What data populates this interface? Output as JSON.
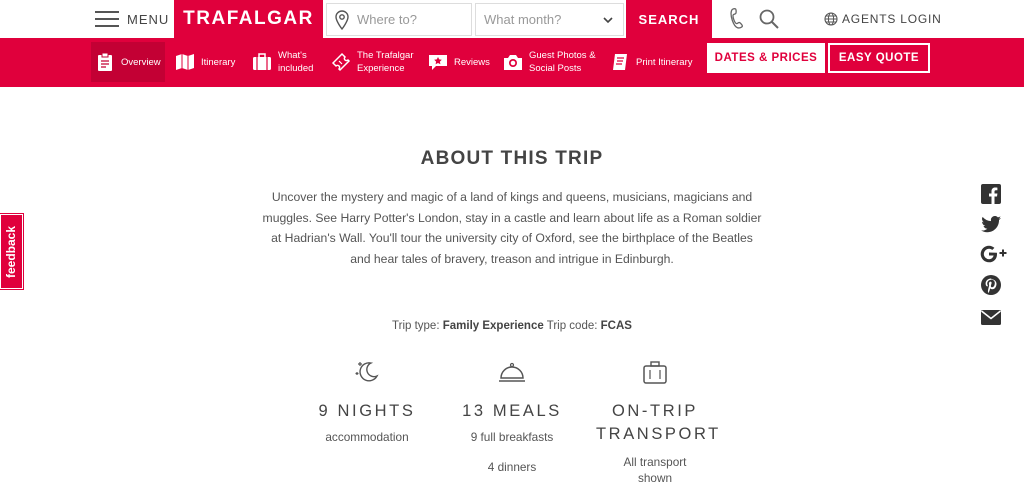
{
  "header": {
    "menu_label": "MENU",
    "logo": "TRAFALGAR",
    "where_placeholder": "Where to?",
    "month_placeholder": "What month?",
    "search_label": "SEARCH",
    "agents_login": "AGENTS LOGIN"
  },
  "nav": {
    "items": [
      {
        "label": "Overview",
        "icon": "clipboard-icon"
      },
      {
        "label": "Itinerary",
        "icon": "map-icon"
      },
      {
        "label": "What's included",
        "label_lines": [
          "What's",
          "included"
        ],
        "icon": "suitcase-icon"
      },
      {
        "label": "The Trafalgar Experience",
        "label_lines": [
          "The Trafalgar",
          "Experience"
        ],
        "icon": "ticket-icon"
      },
      {
        "label": "Reviews",
        "icon": "reviews-icon"
      },
      {
        "label": "Guest Photos & Social Posts",
        "label_lines": [
          "Guest Photos &",
          "Social Posts"
        ],
        "icon": "camera-icon"
      },
      {
        "label": "Print Itinerary",
        "icon": "print-icon"
      }
    ],
    "dates_prices": "DATES & PRICES",
    "easy_quote": "EASY QUOTE"
  },
  "main": {
    "title": "ABOUT THIS TRIP",
    "description": "Uncover the mystery and magic of a land of kings and queens, musicians, magicians and muggles. See Harry Potter's London, stay in a castle and learn about life as a Roman soldier at Hadrian's Wall. You'll tour the university city of Oxford, see the birthplace of the Beatles and hear tales of bravery, treason and intrigue in Edinburgh.",
    "trip_type_label": "Trip type:",
    "trip_type": "Family Experience",
    "trip_code_label": "Trip code:",
    "trip_code": "FCAS"
  },
  "features": [
    {
      "heading": "9 NIGHTS",
      "lines": [
        "accommodation"
      ],
      "icon": "moon-stars-icon"
    },
    {
      "heading": "13 MEALS",
      "lines": [
        "9 full breakfasts",
        "4 dinners"
      ],
      "icon": "cloche-icon"
    },
    {
      "heading_lines": [
        "ON-TRIP",
        "TRANSPORT"
      ],
      "lines": [
        "All transport",
        "shown"
      ],
      "icon": "luggage-icon"
    }
  ],
  "feedback_label": "feedback",
  "social": [
    "facebook-icon",
    "twitter-icon",
    "google-plus-icon",
    "pinterest-icon",
    "email-icon"
  ],
  "colors": {
    "brand_red": "#e0003c",
    "active_red": "#c30034"
  }
}
